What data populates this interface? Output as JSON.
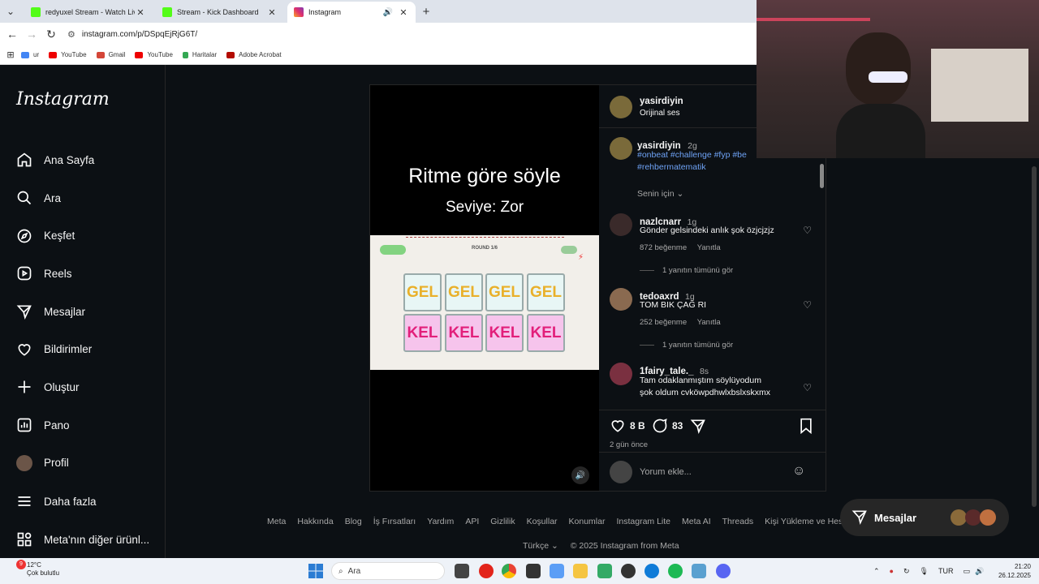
{
  "browser": {
    "tabs": [
      {
        "title": "redyuxel Stream - Watch Live o",
        "color": "#53fc18"
      },
      {
        "title": "Stream - Kick Dashboard",
        "color": "#53fc18"
      },
      {
        "title": "Instagram",
        "color": "#e1306c"
      }
    ],
    "url": "instagram.com/p/DSpqEjRjG6T/",
    "bookmarks": [
      "ur",
      "YouTube",
      "Gmail",
      "YouTube",
      "Haritalar",
      "Adobe Acrobat"
    ]
  },
  "sidebar": {
    "logo": "Instagram",
    "items": [
      {
        "label": "Ana Sayfa",
        "icon": "home-icon"
      },
      {
        "label": "Ara",
        "icon": "search-icon"
      },
      {
        "label": "Keşfet",
        "icon": "compass-icon"
      },
      {
        "label": "Reels",
        "icon": "reels-icon"
      },
      {
        "label": "Mesajlar",
        "icon": "send-icon"
      },
      {
        "label": "Bildirimler",
        "icon": "heart-icon"
      },
      {
        "label": "Oluştur",
        "icon": "plus-icon"
      },
      {
        "label": "Pano",
        "icon": "dashboard-icon"
      },
      {
        "label": "Profil",
        "icon": "avatar"
      }
    ],
    "more": [
      {
        "label": "Daha fazla",
        "icon": "menu-icon"
      },
      {
        "label": "Meta'nın diğer ürünl...",
        "icon": "apps-icon"
      }
    ]
  },
  "video": {
    "title": "Ritme göre söyle",
    "subtitle": "Seviye: Zor",
    "round": "ROUND 1/6",
    "row1": [
      "GEL",
      "GEL",
      "GEL",
      "GEL"
    ],
    "row2": [
      "KEL",
      "KEL",
      "KEL",
      "KEL"
    ]
  },
  "post": {
    "author": "yasirdiyin",
    "audio": "Orijinal ses",
    "caption_time": "2g",
    "caption_tags": "#onbeat #challenge #fyp #be",
    "caption_tags2": "#rehbermatematik",
    "for_you": "Senin için",
    "comments": [
      {
        "user": "nazlcnarr",
        "time": "1g",
        "text": "Gönder gelsindeki anlık şok özjcjzjz",
        "likes": "872 beğenme",
        "reply": "Yanıtla",
        "view": "1 yanıtın tümünü gör"
      },
      {
        "user": "tedoaxrd",
        "time": "1g",
        "text": "TOM BIK ÇAĞ RI",
        "likes": "252 beğenme",
        "reply": "Yanıtla",
        "view": "1 yanıtın tümünü gör"
      },
      {
        "user": "1fairy_tale._",
        "time": "8s",
        "text": "Tam odaklanmıştım söylüyodum",
        "text2": "şok oldum cvköwpdhwlxbslxskxmx"
      }
    ],
    "like_count": "8 B",
    "comment_count": "83",
    "posted": "2 gün önce",
    "add_comment_placeholder": "Yorum ekle..."
  },
  "footer": {
    "links": [
      "Meta",
      "Hakkında",
      "Blog",
      "İş Fırsatları",
      "Yardım",
      "API",
      "Gizlilik",
      "Koşullar",
      "Konumlar",
      "Instagram Lite",
      "Meta AI",
      "Threads",
      "Kişi Yükleme ve Hesabı Olmaya"
    ],
    "language": "Türkçe",
    "copyright": "© 2025 Instagram from Meta"
  },
  "messages_button": "Mesajlar",
  "taskbar": {
    "temp": "12°C",
    "weather": "Çok bulutlu",
    "search": "Ara",
    "lang": "TUR",
    "time": "21:20",
    "date": "26.12.2025",
    "badge": "9"
  }
}
